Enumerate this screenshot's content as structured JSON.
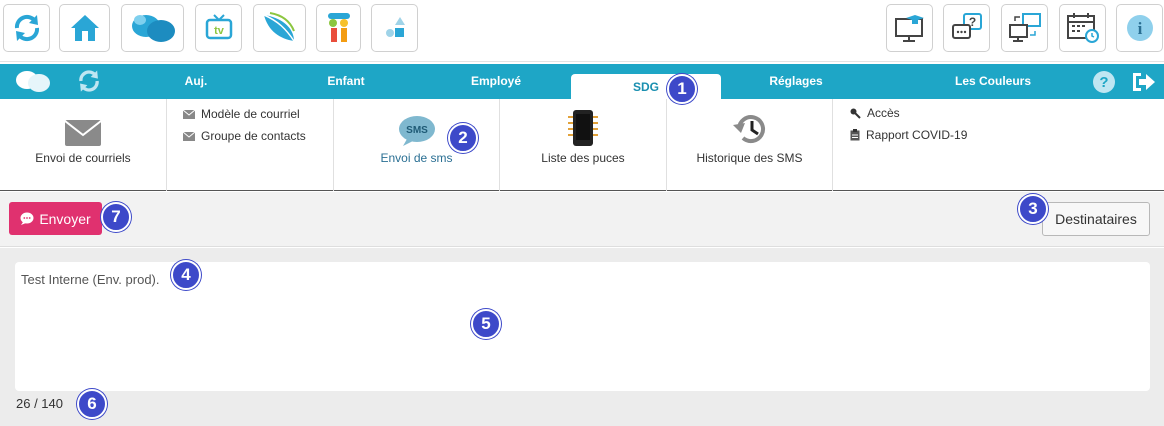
{
  "toolbar": {
    "left_icons": [
      "refresh-icon",
      "home-icon",
      "butterfly-icon",
      "tv-icon",
      "leaf-icon",
      "children-icon",
      "shapes-icon"
    ],
    "tv_label": "tv",
    "right_icons": [
      "training-icon",
      "help-chat-icon",
      "sync-screens-icon",
      "calendar-clock-icon",
      "info-icon"
    ],
    "help_chat_glyph": "?",
    "info_glyph": "i"
  },
  "nav": {
    "tabs": [
      {
        "label": "Auj."
      },
      {
        "label": "Enfant"
      },
      {
        "label": "Employé"
      },
      {
        "label": "SDG"
      },
      {
        "label": "Réglages"
      },
      {
        "label": "Les Couleurs"
      }
    ],
    "active_tab": "SDG",
    "help_glyph": "?"
  },
  "submenu": {
    "email_send": "Envoi de courriels",
    "email_links": [
      "Modèle de courriel",
      "Groupe de contacts"
    ],
    "sms_icon_text": "SMS",
    "sms_send": "Envoi de sms",
    "chips_list": "Liste des puces",
    "sms_history": "Historique des SMS",
    "right_links": [
      "Accès",
      "Rapport COVID-19"
    ]
  },
  "actions": {
    "send_label": "Envoyer",
    "recipients_label": "Destinataires"
  },
  "message": {
    "text": "Test Interne (Env. prod).",
    "counter": "26 / 140"
  },
  "badges": [
    "1",
    "2",
    "3",
    "4",
    "5",
    "6",
    "7"
  ],
  "colors": {
    "nav_blue": "#1ea6c6",
    "send_pink": "#e0316f",
    "badge_blue": "#3d49c9",
    "active_tab_text": "#1a8fb0"
  }
}
